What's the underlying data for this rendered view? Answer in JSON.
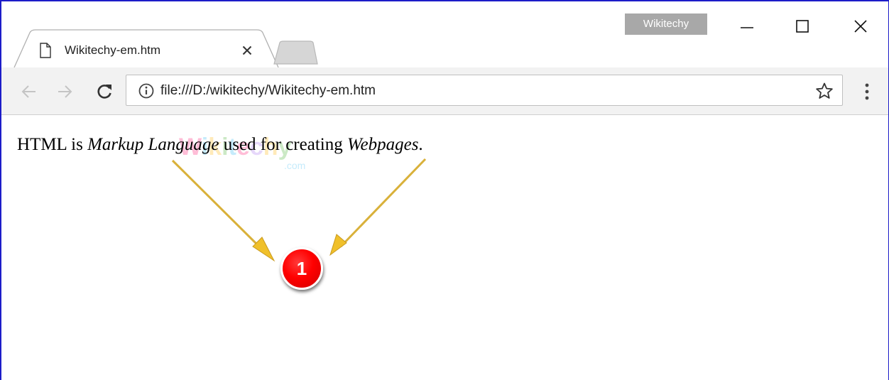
{
  "window": {
    "profile_badge": "Wikitechy",
    "controls": {
      "minimize": "minimize",
      "maximize": "maximize",
      "close": "close"
    }
  },
  "tab": {
    "title": "Wikitechy-em.htm",
    "icon": "document-icon",
    "close_icon": "close-icon"
  },
  "toolbar": {
    "back_icon": "arrow-left-icon",
    "forward_icon": "arrow-right-icon",
    "reload_icon": "reload-icon",
    "info_icon": "info-icon",
    "url": "file:///D:/wikitechy/Wikitechy-em.htm",
    "bookmark_icon": "star-icon",
    "menu_icon": "kebab-menu-icon"
  },
  "page": {
    "text_part1": "HTML is ",
    "em1": "Markup Language",
    "text_part2": " used for creating ",
    "em2": "Webpages",
    "text_part3": ".",
    "watermark": "Wikitechy",
    "watermark_sub": ".com"
  },
  "annotation": {
    "badge_number": "1",
    "badge_color": "#ff0000",
    "arrow_color": "#d9b13a"
  }
}
